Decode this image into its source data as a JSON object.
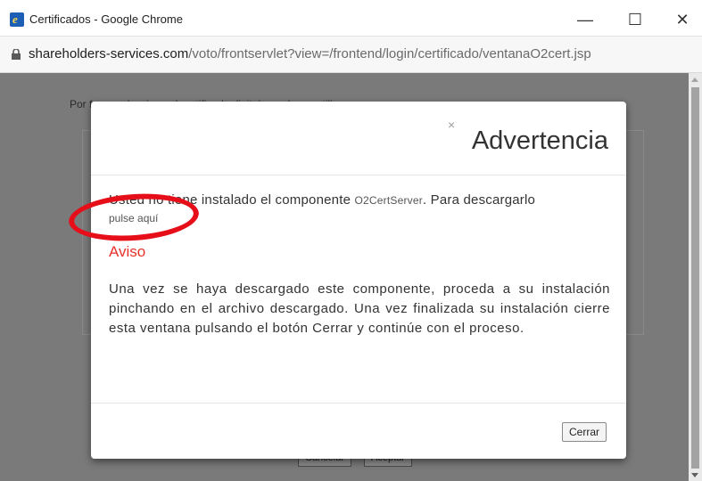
{
  "window": {
    "title": "Certificados - Google Chrome",
    "minimize": "—",
    "maximize": "☐",
    "close": "✕"
  },
  "address": {
    "host": "shareholders-services.com",
    "path": "/voto/frontservlet?view=/frontend/login/certificado/ventanaO2cert.jsp"
  },
  "background_page": {
    "text": "Por favor seleccione el certificado digital que desea utilizar",
    "cancel_label": "Cancelar",
    "accept_label": "Aceptar"
  },
  "modal": {
    "close_glyph": "×",
    "title": "Advertencia",
    "p1_before": "Usted no tiene instalado el componente ",
    "component": "O2CertServer",
    "p1_after": ". Para descargarlo",
    "link": "pulse aquí",
    "aviso": "Aviso",
    "p2": "Una vez se haya descargado este componente, proceda a su instalación pinchando en el archivo descargado. Una vez finalizada su instalación cierre esta ventana pulsando el botón Cerrar y continúe con el proceso.",
    "close_button": "Cerrar"
  },
  "colors": {
    "overlay": "#7a7a7a",
    "aviso_red": "#e8322a",
    "annotation_red": "#e60e19"
  }
}
